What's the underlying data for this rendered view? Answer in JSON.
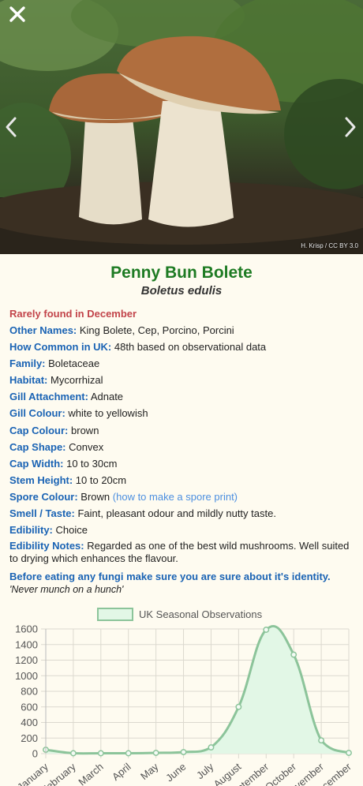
{
  "photo": {
    "credit": "H. Krisp / CC BY 3.0",
    "close_icon": "close-icon",
    "prev_icon": "chevron-left-icon",
    "next_icon": "chevron-right-icon"
  },
  "mushroom": {
    "name": "Penny Bun Bolete",
    "latin": "Boletus edulis",
    "rarity": "Rarely found in December",
    "fields": [
      {
        "label": "Other Names:",
        "value": "King Bolete, Cep, Porcino, Porcini"
      },
      {
        "label": "How Common in UK:",
        "value": "48th based on observational data"
      },
      {
        "label": "Family:",
        "value": "Boletaceae"
      },
      {
        "label": "Habitat:",
        "value": "Mycorrhizal"
      },
      {
        "label": "Gill Attachment:",
        "value": "Adnate"
      },
      {
        "label": "Gill Colour:",
        "value": "white to yellowish"
      },
      {
        "label": "Cap Colour:",
        "value": "brown"
      },
      {
        "label": "Cap Shape:",
        "value": "Convex"
      },
      {
        "label": "Cap Width:",
        "value": "10 to 30cm"
      },
      {
        "label": "Stem Height:",
        "value": "10 to 20cm"
      }
    ],
    "spore": {
      "label": "Spore Colour:",
      "value": "Brown",
      "link": "(how to make a spore print)"
    },
    "smell": {
      "label": "Smell / Taste:",
      "value": "Faint, pleasant odour and mildly nutty taste."
    },
    "edibility": {
      "label": "Edibility:",
      "value": "Choice"
    },
    "notes": {
      "label": "Edibility Notes:",
      "value": "Regarded as one of the best wild mushrooms. Well suited to drying which enhances the flavour."
    },
    "warning": "Before eating any fungi make sure you are sure about it's identity.",
    "motto": "'Never munch on a hunch'"
  },
  "chart_data": {
    "type": "area",
    "legend": "UK Seasonal Observations",
    "legend_position": "top",
    "categories": [
      "January",
      "February",
      "March",
      "April",
      "May",
      "June",
      "July",
      "August",
      "September",
      "October",
      "November",
      "December"
    ],
    "series": [
      {
        "name": "UK Seasonal Observations",
        "values": [
          50,
          5,
          5,
          5,
          10,
          20,
          80,
          600,
          1590,
          1270,
          170,
          10
        ]
      }
    ],
    "ylim": [
      0,
      1600
    ],
    "yticks": [
      0,
      200,
      400,
      600,
      800,
      1000,
      1200,
      1400,
      1600
    ],
    "grid": true,
    "line_color": "#8cc49a",
    "fill_color": "#e2f7e6"
  }
}
